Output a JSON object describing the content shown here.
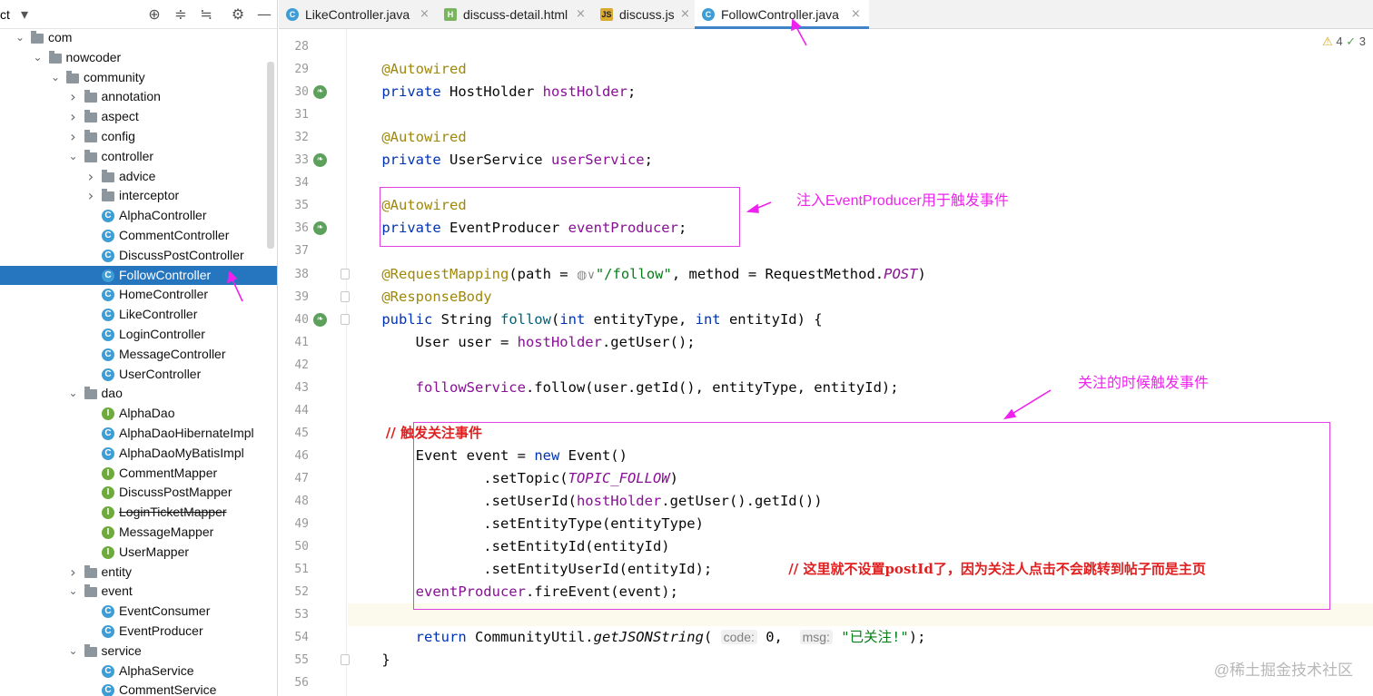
{
  "sidebar": {
    "header_fragment": "ct",
    "icons": [
      "chevron-down-icon",
      "crosshair-icon",
      "expand-all-icon",
      "collapse-all-icon",
      "gear-icon",
      "minimize-icon"
    ],
    "tree": [
      {
        "label": "com",
        "type": "folder",
        "depth": 0,
        "expanded": true
      },
      {
        "label": "nowcoder",
        "type": "folder",
        "depth": 1,
        "expanded": true
      },
      {
        "label": "community",
        "type": "folder",
        "depth": 2,
        "expanded": true
      },
      {
        "label": "annotation",
        "type": "folder",
        "depth": 3,
        "expanded": false
      },
      {
        "label": "aspect",
        "type": "folder",
        "depth": 3,
        "expanded": false
      },
      {
        "label": "config",
        "type": "folder",
        "depth": 3,
        "expanded": false
      },
      {
        "label": "controller",
        "type": "folder",
        "depth": 3,
        "expanded": true
      },
      {
        "label": "advice",
        "type": "folder",
        "depth": 4,
        "expanded": false
      },
      {
        "label": "interceptor",
        "type": "folder",
        "depth": 4,
        "expanded": false
      },
      {
        "label": "AlphaController",
        "type": "class",
        "depth": 4
      },
      {
        "label": "CommentController",
        "type": "class",
        "depth": 4
      },
      {
        "label": "DiscussPostController",
        "type": "class",
        "depth": 4
      },
      {
        "label": "FollowController",
        "type": "class",
        "depth": 4,
        "selected": true
      },
      {
        "label": "HomeController",
        "type": "class",
        "depth": 4
      },
      {
        "label": "LikeController",
        "type": "class",
        "depth": 4
      },
      {
        "label": "LoginController",
        "type": "class",
        "depth": 4
      },
      {
        "label": "MessageController",
        "type": "class",
        "depth": 4
      },
      {
        "label": "UserController",
        "type": "class",
        "depth": 4
      },
      {
        "label": "dao",
        "type": "folder",
        "depth": 3,
        "expanded": true
      },
      {
        "label": "AlphaDao",
        "type": "interface",
        "depth": 4
      },
      {
        "label": "AlphaDaoHibernateImpl",
        "type": "class",
        "depth": 4
      },
      {
        "label": "AlphaDaoMyBatisImpl",
        "type": "class",
        "depth": 4
      },
      {
        "label": "CommentMapper",
        "type": "interface",
        "depth": 4
      },
      {
        "label": "DiscussPostMapper",
        "type": "interface",
        "depth": 4
      },
      {
        "label": "LoginTicketMapper",
        "type": "interface",
        "depth": 4,
        "deprecated": true
      },
      {
        "label": "MessageMapper",
        "type": "interface",
        "depth": 4
      },
      {
        "label": "UserMapper",
        "type": "interface",
        "depth": 4
      },
      {
        "label": "entity",
        "type": "folder",
        "depth": 3,
        "expanded": false
      },
      {
        "label": "event",
        "type": "folder",
        "depth": 3,
        "expanded": true
      },
      {
        "label": "EventConsumer",
        "type": "class",
        "depth": 4
      },
      {
        "label": "EventProducer",
        "type": "class",
        "depth": 4
      },
      {
        "label": "service",
        "type": "folder",
        "depth": 3,
        "expanded": true
      },
      {
        "label": "AlphaService",
        "type": "class",
        "depth": 4
      },
      {
        "label": "CommentService",
        "type": "class",
        "depth": 4
      }
    ]
  },
  "tabs": [
    {
      "label": "LikeController.java",
      "icon": "class-icon",
      "active": false
    },
    {
      "label": "discuss-detail.html",
      "icon": "html-file-icon",
      "active": false
    },
    {
      "label": "discuss.js",
      "icon": "js-file-icon",
      "active": false
    },
    {
      "label": "FollowController.java",
      "icon": "class-icon",
      "active": true
    }
  ],
  "inspections": {
    "warnings": "4",
    "ok": "3"
  },
  "editor": {
    "lines": [
      {
        "num": "28",
        "tokens": []
      },
      {
        "num": "29",
        "tokens": [
          [
            "ann",
            "    @Autowired"
          ]
        ]
      },
      {
        "num": "30",
        "bean": true,
        "tokens": [
          [
            "kw",
            "    private "
          ],
          [
            "",
            "HostHolder "
          ],
          [
            "fld",
            "hostHolder"
          ],
          [
            "",
            ";"
          ]
        ]
      },
      {
        "num": "31",
        "tokens": []
      },
      {
        "num": "32",
        "tokens": [
          [
            "ann",
            "    @Autowired"
          ]
        ]
      },
      {
        "num": "33",
        "bean": true,
        "tokens": [
          [
            "kw",
            "    private "
          ],
          [
            "",
            "UserService "
          ],
          [
            "fld",
            "userService"
          ],
          [
            "",
            ";"
          ]
        ]
      },
      {
        "num": "34",
        "tokens": []
      },
      {
        "num": "35",
        "tokens": [
          [
            "ann",
            "    @Autowired"
          ]
        ]
      },
      {
        "num": "36",
        "bean": true,
        "tokens": [
          [
            "kw",
            "    private "
          ],
          [
            "",
            "EventProducer "
          ],
          [
            "fld",
            "eventProducer"
          ],
          [
            "",
            ";"
          ]
        ]
      },
      {
        "num": "37",
        "tokens": []
      },
      {
        "num": "38",
        "fold": true,
        "tokens": [
          [
            "ann",
            "    @RequestMapping"
          ],
          [
            "",
            "(path = "
          ],
          [
            "globe",
            "◍∨"
          ],
          [
            "str",
            "\"/follow\""
          ],
          [
            "",
            ", method = RequestMethod."
          ],
          [
            "cst",
            "POST"
          ],
          [
            "",
            ")"
          ]
        ]
      },
      {
        "num": "39",
        "fold": true,
        "tokens": [
          [
            "ann",
            "    @ResponseBody"
          ]
        ]
      },
      {
        "num": "40",
        "bean": true,
        "fold": true,
        "tokens": [
          [
            "kw",
            "    public "
          ],
          [
            "",
            "String "
          ],
          [
            "meth",
            "follow"
          ],
          [
            "",
            "("
          ],
          [
            "kw",
            "int "
          ],
          [
            "",
            "entityType, "
          ],
          [
            "kw",
            "int "
          ],
          [
            "",
            "entityId) {"
          ]
        ]
      },
      {
        "num": "41",
        "tokens": [
          [
            "",
            "        User user = "
          ],
          [
            "fld",
            "hostHolder"
          ],
          [
            "",
            ".getUser();"
          ]
        ]
      },
      {
        "num": "42",
        "tokens": []
      },
      {
        "num": "43",
        "tokens": [
          [
            "fld",
            "        followService"
          ],
          [
            "",
            ".follow(user.getId(), entityType, entityId);"
          ]
        ]
      },
      {
        "num": "44",
        "tokens": []
      },
      {
        "num": "45",
        "tokens": [
          [
            "cmt",
            "        // 触发关注事件"
          ]
        ]
      },
      {
        "num": "46",
        "tokens": [
          [
            "",
            "        Event event = "
          ],
          [
            "kw",
            "new "
          ],
          [
            "",
            "Event()"
          ]
        ]
      },
      {
        "num": "47",
        "tokens": [
          [
            "",
            "                .setTopic("
          ],
          [
            "cst",
            "TOPIC_FOLLOW"
          ],
          [
            "",
            ")"
          ]
        ]
      },
      {
        "num": "48",
        "tokens": [
          [
            "",
            "                .setUserId("
          ],
          [
            "fld",
            "hostHolder"
          ],
          [
            "",
            ".getUser().getId())"
          ]
        ]
      },
      {
        "num": "49",
        "tokens": [
          [
            "",
            "                .setEntityType(entityType)"
          ]
        ]
      },
      {
        "num": "50",
        "tokens": [
          [
            "",
            "                .setEntityId(entityId)"
          ]
        ]
      },
      {
        "num": "51",
        "tokens": [
          [
            "",
            "                .setEntityUserId(entityId);         "
          ],
          [
            "cmt",
            "// 这里就不设置postId了，因为关注人点击不会跳转到帖子而是主页"
          ]
        ]
      },
      {
        "num": "52",
        "tokens": [
          [
            "fld",
            "        eventProducer"
          ],
          [
            "",
            ".fireEvent(event);"
          ]
        ]
      },
      {
        "num": "53",
        "current": true,
        "tokens": []
      },
      {
        "num": "54",
        "tokens": [
          [
            "kw",
            "        return "
          ],
          [
            "",
            "CommunityUtil."
          ],
          [
            "it",
            "getJSONString"
          ],
          [
            "",
            "( "
          ],
          [
            "hint",
            "code:"
          ],
          [
            "",
            " 0,  "
          ],
          [
            "hint",
            "msg:"
          ],
          [
            "",
            " "
          ],
          [
            "str",
            "\"已关注!\""
          ],
          [
            "",
            ");"
          ]
        ]
      },
      {
        "num": "55",
        "fold": true,
        "tokens": [
          [
            "",
            "    }"
          ]
        ]
      },
      {
        "num": "56",
        "tokens": []
      }
    ]
  },
  "annotations": {
    "inject_note": "注入EventProducer用于触发事件",
    "follow_note": "关注的时候触发事件"
  },
  "watermark": "@稀土掘金技术社区"
}
